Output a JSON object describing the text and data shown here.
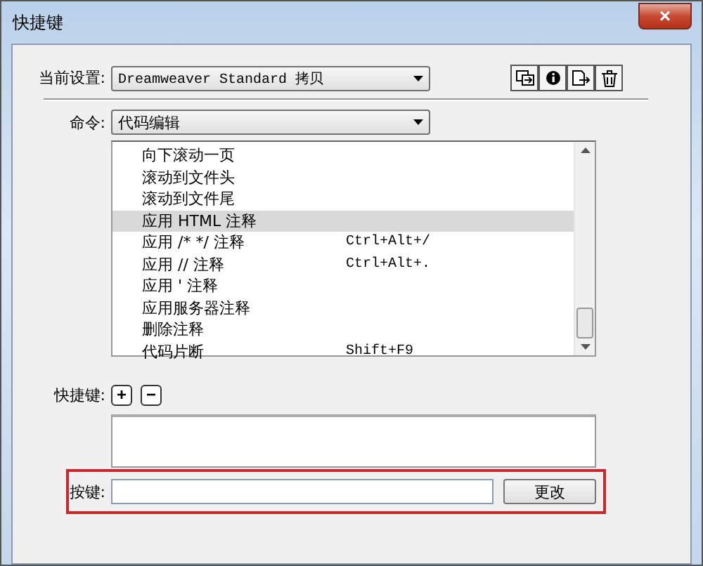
{
  "window": {
    "title": "快捷键",
    "close": "×"
  },
  "current_setting": {
    "label": "当前设置:",
    "value": "Dreamweaver Standard 拷贝"
  },
  "command": {
    "label": "命令:",
    "value": "代码编辑"
  },
  "commands": [
    {
      "name": "向下滚动一页",
      "selected": false
    },
    {
      "name": "滚动到文件头",
      "selected": false
    },
    {
      "name": "滚动到文件尾",
      "selected": false
    },
    {
      "name": "应用 HTML 注释",
      "selected": true
    },
    {
      "name": "应用 /* */ 注释",
      "shortcut": "Ctrl+Alt+/",
      "selected": false
    },
    {
      "name": "应用 // 注释",
      "shortcut": "Ctrl+Alt+.",
      "selected": false
    },
    {
      "name": "应用 ' 注释",
      "selected": false
    },
    {
      "name": "应用服务器注释",
      "selected": false
    },
    {
      "name": "删除注释",
      "selected": false
    },
    {
      "name": "代码片断",
      "shortcut": "Shift+F9",
      "selected": false
    }
  ],
  "shortcuts": {
    "label": "快捷键:",
    "add": "+",
    "remove": "−"
  },
  "keypress": {
    "label": "按键:",
    "button": "更改"
  }
}
